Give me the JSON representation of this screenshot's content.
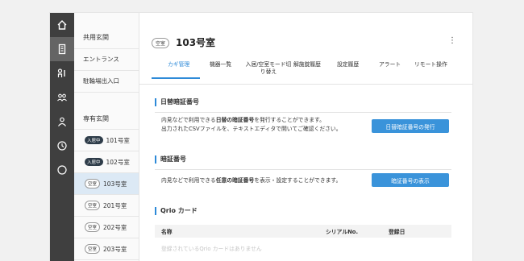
{
  "rail": [
    "home-icon",
    "building-icon",
    "key-person-icon",
    "group-icon",
    "person-icon",
    "clock-icon",
    "more-icon"
  ],
  "sidebar": {
    "shared_header": "共用玄関",
    "shared_links": [
      "エントランス",
      "駐輪場出入口"
    ],
    "private_header": "専有玄関",
    "rooms": [
      {
        "status": "入居中",
        "name": "101号室"
      },
      {
        "status": "入居中",
        "name": "102号室"
      },
      {
        "status": "空室",
        "name": "103号室"
      },
      {
        "status": "空室",
        "name": "201号室"
      },
      {
        "status": "空室",
        "name": "202号室"
      },
      {
        "status": "空室",
        "name": "203号室"
      }
    ]
  },
  "header": {
    "status": "空室",
    "title": "103号室",
    "menu": "⋮"
  },
  "tabs": [
    "カギ管理",
    "機器一覧",
    "入居/空室モード切り替え",
    "解施錠履歴",
    "設定履歴",
    "アラート",
    "リモート操作"
  ],
  "sections": {
    "daily": {
      "title": "日替暗証番号",
      "line1_pre": "内見などで利用できる",
      "line1_bold": "日替の暗証番号",
      "line1_post": "を発行することができます。",
      "line2": "出力されたCSVファイルを、テキストエディタで開いてご確認ください。",
      "button": "日替暗証番号の発行"
    },
    "pin": {
      "title": "暗証番号",
      "line_pre": "内見などで利用できる",
      "line_bold": "任意の暗証番号",
      "line_post": "を表示・設定することができます。",
      "button": "暗証番号の表示"
    },
    "qrio": {
      "title": "Qrio カード",
      "columns": [
        "名称",
        "シリアルNo.",
        "登録日"
      ],
      "empty": "登録されているQrio カードはありません"
    }
  }
}
